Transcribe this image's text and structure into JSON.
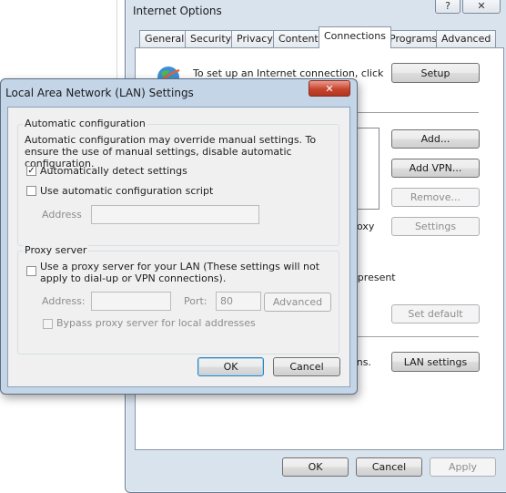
{
  "internet_options": {
    "title": "Internet Options",
    "help_glyph": "?",
    "close_glyph": "✕",
    "tabs": [
      {
        "label": "General"
      },
      {
        "label": "Security"
      },
      {
        "label": "Privacy"
      },
      {
        "label": "Content"
      },
      {
        "label": "Connections"
      },
      {
        "label": "Programs"
      },
      {
        "label": "Advanced"
      }
    ],
    "active_tab": "Connections",
    "setup_text": "To set up an Internet connection, click",
    "partial_text_proxy": "oxy",
    "partial_text_present": "t present",
    "partial_text_lan": "ons.",
    "buttons": {
      "setup": "Setup",
      "add": "Add...",
      "add_vpn": "Add VPN...",
      "remove": "Remove...",
      "settings": "Settings",
      "set_default": "Set default",
      "lan_settings": "LAN settings",
      "ok": "OK",
      "cancel": "Cancel",
      "apply": "Apply"
    }
  },
  "lan_dialog": {
    "title": "Local Area Network (LAN) Settings",
    "close_glyph": "✕",
    "auto_config": {
      "group_label": "Automatic configuration",
      "description": "Automatic configuration may override manual settings.  To ensure the use of manual settings, disable automatic configuration.",
      "auto_detect_label": "Automatically detect settings",
      "auto_detect_checked": true,
      "use_script_label": "Use automatic configuration script",
      "use_script_checked": false,
      "address_label": "Address",
      "address_value": ""
    },
    "proxy": {
      "group_label": "Proxy server",
      "use_proxy_label": "Use a proxy server for your LAN (These settings will not apply to dial-up or VPN connections).",
      "use_proxy_checked": false,
      "address_label": "Address:",
      "address_value": "",
      "port_label": "Port:",
      "port_value": "80",
      "advanced_label": "Advanced",
      "bypass_label": "Bypass proxy server for local addresses",
      "bypass_checked": false
    },
    "buttons": {
      "ok": "OK",
      "cancel": "Cancel"
    }
  }
}
